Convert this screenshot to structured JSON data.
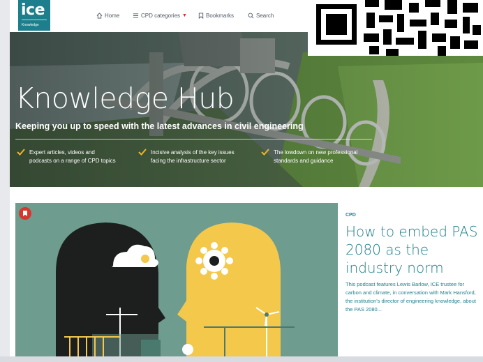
{
  "brand": {
    "logo_text": "ice",
    "logo_sub": "Knowledge",
    "accent": "#1d7f8c",
    "alert": "#d4382c"
  },
  "nav": {
    "items": [
      {
        "label": "Home",
        "icon": "home-icon"
      },
      {
        "label": "CPD categories",
        "icon": "list-icon",
        "has_dropdown": true
      },
      {
        "label": "Bookmarks",
        "icon": "bookmark-icon"
      },
      {
        "label": "Search",
        "icon": "search-icon"
      }
    ],
    "dropdown_caret": "▼"
  },
  "hero": {
    "title": "Knowledge Hub",
    "subtitle": "Keeping you up to speed with the latest advances in civil engineering",
    "features": [
      {
        "line1": "Expert articles, videos and",
        "line2": "podcasts on a range of CPD topics"
      },
      {
        "line1": "Incisive analysis of the key issues",
        "line2": "facing the infrastructure sector"
      },
      {
        "line1": "The lowdown on new professional",
        "line2": "standards and guidance"
      }
    ],
    "check_color": "#f0b429"
  },
  "article": {
    "category": "CPD",
    "title": "How to embed PAS 2080 as the industry norm",
    "summary": "This podcast features Lewis Barlow, ICE trustee for carbon and climate, in conversation with Mark Hansford, the institution's director of engineering knowledge, about the PAS 2080..."
  }
}
